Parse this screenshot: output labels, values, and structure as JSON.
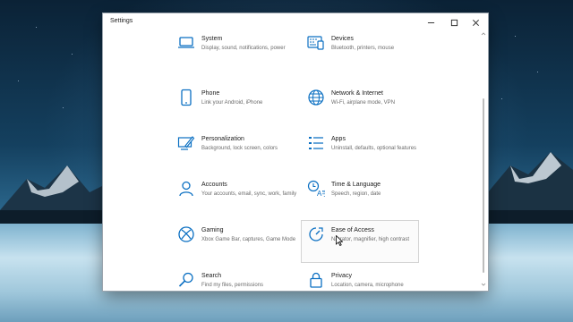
{
  "window": {
    "title": "Settings"
  },
  "controls": {
    "minimize_icon": "minimize-icon",
    "maximize_icon": "maximize-icon",
    "close_icon": "close-icon"
  },
  "settings": [
    {
      "name": "System",
      "desc": "Display, sound, notifications, power",
      "icon": "laptop-icon"
    },
    {
      "name": "Devices",
      "desc": "Bluetooth, printers, mouse",
      "icon": "keyboard-icon"
    },
    {
      "name": "Phone",
      "desc": "Link your Android, iPhone",
      "icon": "phone-icon"
    },
    {
      "name": "Network & Internet",
      "desc": "Wi-Fi, airplane mode, VPN",
      "icon": "globe-icon"
    },
    {
      "name": "Personalization",
      "desc": "Background, lock screen, colors",
      "icon": "brush-icon"
    },
    {
      "name": "Apps",
      "desc": "Uninstall, defaults, optional features",
      "icon": "apps-list-icon"
    },
    {
      "name": "Accounts",
      "desc": "Your accounts, email, sync, work, family",
      "icon": "person-icon"
    },
    {
      "name": "Time & Language",
      "desc": "Speech, region, date",
      "icon": "time-language-icon"
    },
    {
      "name": "Gaming",
      "desc": "Xbox Game Bar, captures, Game Mode",
      "icon": "xbox-icon"
    },
    {
      "name": "Ease of Access",
      "desc": "Narrator, magnifier, high contrast",
      "icon": "ease-of-access-icon"
    },
    {
      "name": "Search",
      "desc": "Find my files, permissions",
      "icon": "search-icon"
    },
    {
      "name": "Privacy",
      "desc": "Location, camera, microphone",
      "icon": "lock-icon"
    }
  ],
  "colors": {
    "accent": "#0a6fc2"
  }
}
